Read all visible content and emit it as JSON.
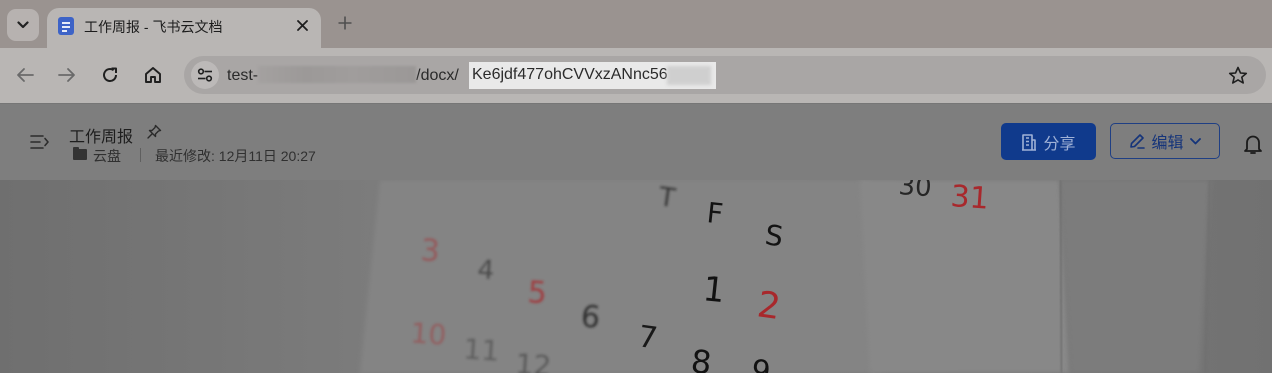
{
  "browser": {
    "tab": {
      "title": "工作周报 - 飞书云文档"
    },
    "url": {
      "prefix": "test-",
      "path": "/docx/",
      "selected": "Ke6jdf477ohCVVxzANnc56"
    }
  },
  "doc": {
    "title": "工作周报",
    "location": "云盘",
    "last_modified": "最近修改: 12月11日 20:27",
    "share_label": "分享",
    "edit_label": "编辑"
  },
  "cover": {
    "calendar_labels": [
      "T",
      "F",
      "S",
      "30",
      "31",
      "3",
      "4",
      "5",
      "6",
      "7",
      "1",
      "2",
      "8",
      "10",
      "11",
      "12",
      "9"
    ]
  },
  "colors": {
    "accent": "#103a8c",
    "favicon": "#3d63c7",
    "weekend_red": "#a8282c"
  },
  "icons": {
    "tab_favicon": "doc-icon",
    "outline": "outline-toggle-icon",
    "pin": "pin-icon",
    "folder": "folder-icon",
    "share": "building-icon",
    "edit": "pencil-icon",
    "notifications": "bell-icon"
  }
}
